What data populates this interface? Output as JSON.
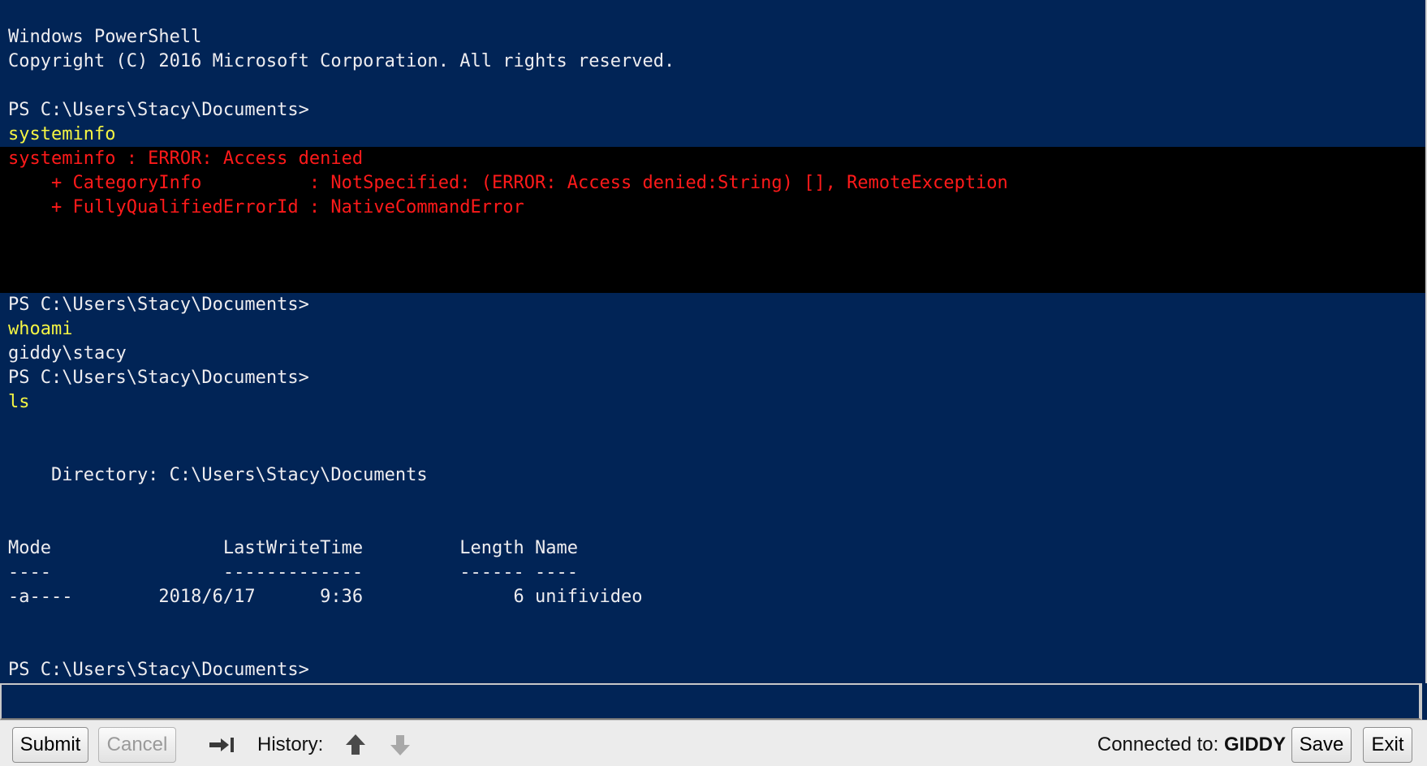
{
  "console": {
    "header_line1": "Windows PowerShell",
    "header_line2": "Copyright (C) 2016 Microsoft Corporation. All rights reserved.",
    "prompt": "PS C:\\Users\\Stacy\\Documents>",
    "cmd1": "systeminfo",
    "error_line1": "systeminfo : ERROR: Access denied",
    "error_line2": "    + CategoryInfo          : NotSpecified: (ERROR: Access denied:String) [], RemoteException",
    "error_line3": "    + FullyQualifiedErrorId : NativeCommandError",
    "cmd2": "whoami",
    "whoami_output": "giddy\\stacy",
    "cmd3": "ls",
    "directory_line": "    Directory: C:\\Users\\Stacy\\Documents",
    "table_header": "Mode                LastWriteTime         Length Name",
    "table_separator": "----                -------------         ------ ----",
    "table_rows": [
      "-a----        2018/6/17      9:36              6 unifivideo"
    ]
  },
  "input": {
    "value": ""
  },
  "toolbar": {
    "submit_label": "Submit",
    "cancel_label": "Cancel",
    "history_label": "History:",
    "connected_label": "Connected to:",
    "host": "GIDDY",
    "save_label": "Save",
    "exit_label": "Exit"
  },
  "icons": {
    "tab": "tab-complete-icon",
    "history_up": "arrow-up-icon",
    "history_down": "arrow-down-icon"
  },
  "colors": {
    "console_bg": "#012456",
    "error_bg": "#000000",
    "text": "#eeedf0",
    "command": "#f5f543",
    "error": "#ff1a1a"
  }
}
